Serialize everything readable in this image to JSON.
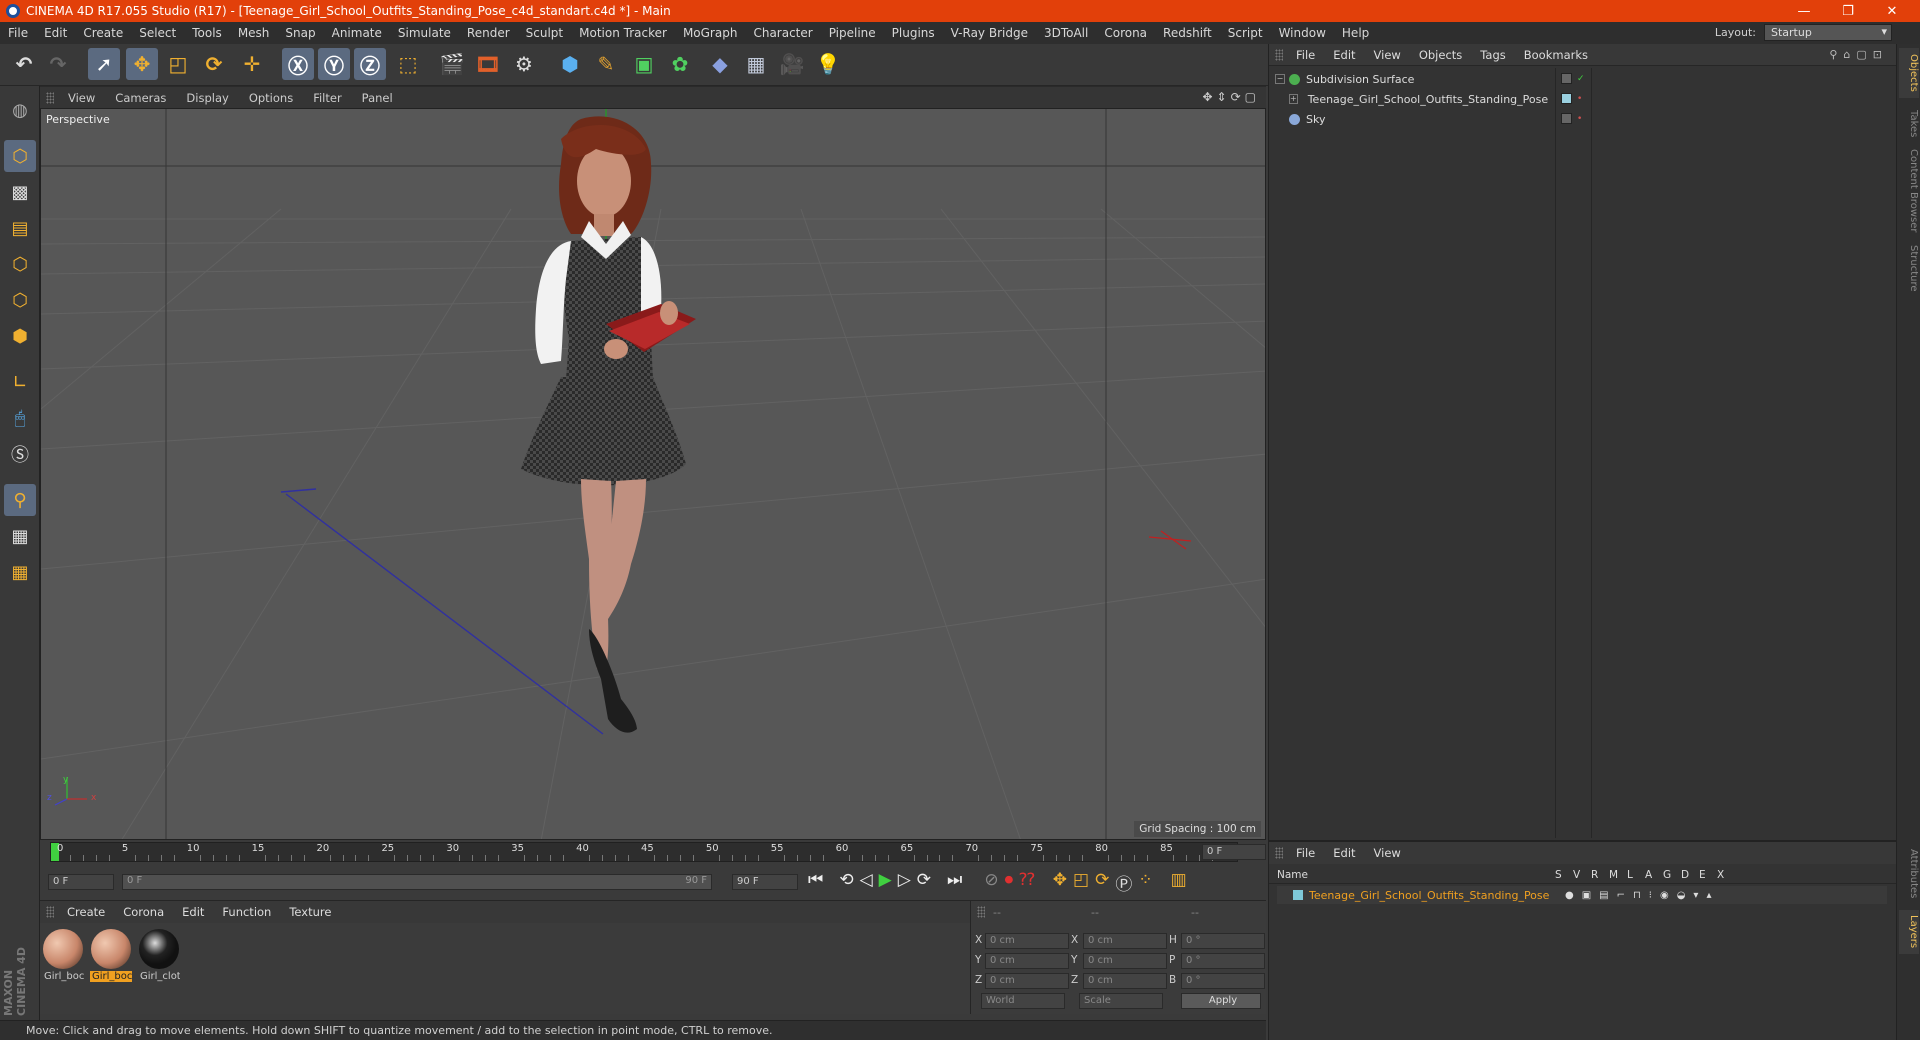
{
  "window": {
    "title": "CINEMA 4D R17.055 Studio (R17) - [Teenage_Girl_School_Outfits_Standing_Pose_c4d_standart.c4d *] - Main",
    "minimize": "—",
    "restore": "❐",
    "close": "✕"
  },
  "menu": [
    "File",
    "Edit",
    "Create",
    "Select",
    "Tools",
    "Mesh",
    "Snap",
    "Animate",
    "Simulate",
    "Render",
    "Sculpt",
    "Motion Tracker",
    "MoGraph",
    "Character",
    "Pipeline",
    "Plugins",
    "V-Ray Bridge",
    "3DToAll",
    "Corona",
    "Redshift",
    "Script",
    "Window",
    "Help"
  ],
  "layout": {
    "label": "Layout:",
    "value": "Startup"
  },
  "viewport": {
    "menu": [
      "View",
      "Cameras",
      "Display",
      "Options",
      "Filter",
      "Panel"
    ],
    "label": "Perspective",
    "grid_spacing": "Grid Spacing : 100 cm",
    "axis": {
      "x": "x",
      "y": "y",
      "z": "z"
    }
  },
  "timeline": {
    "ticks": [
      "0",
      "5",
      "10",
      "15",
      "20",
      "25",
      "30",
      "35",
      "40",
      "45",
      "50",
      "55",
      "60",
      "65",
      "70",
      "75",
      "80",
      "85",
      "90"
    ],
    "current_frame": "0 F",
    "start_field": "0 F",
    "range_start": "0 F",
    "range_end": "90 F",
    "end_field": "90 F"
  },
  "material_manager": {
    "menu": [
      "Create",
      "Corona",
      "Edit",
      "Function",
      "Texture"
    ],
    "materials": [
      {
        "label": "Girl_boc",
        "color": "#c8866a",
        "selected": false
      },
      {
        "label": "Girl_boc",
        "color": "#c8866a",
        "selected": true
      },
      {
        "label": "Girl_clot",
        "color": "#222222",
        "selected": false
      }
    ]
  },
  "coordinates": {
    "headers": [
      "--",
      "--",
      "--"
    ],
    "rows": [
      {
        "a": "X",
        "av": "0 cm",
        "b": "X",
        "bv": "0 cm",
        "c": "H",
        "cv": "0 °"
      },
      {
        "a": "Y",
        "av": "0 cm",
        "b": "Y",
        "bv": "0 cm",
        "c": "P",
        "cv": "0 °"
      },
      {
        "a": "Z",
        "av": "0 cm",
        "b": "Z",
        "bv": "0 cm",
        "c": "B",
        "cv": "0 °"
      }
    ],
    "mode": "World",
    "scale": "Scale",
    "apply": "Apply"
  },
  "status": "Move: Click and drag to move elements. Hold down SHIFT to quantize movement / add to the selection in point mode, CTRL to remove.",
  "object_manager": {
    "menu": [
      "File",
      "Edit",
      "View",
      "Objects",
      "Tags",
      "Bookmarks"
    ],
    "objects": [
      {
        "name": "Subdivision Surface",
        "indent": 0,
        "icon_color": "#4caf50"
      },
      {
        "name": "Teenage_Girl_School_Outfits_Standing_Pose",
        "indent": 1,
        "icon_color": "#9ab0c8"
      },
      {
        "name": "Sky",
        "indent": 0,
        "icon_color": "#8aa8d8"
      }
    ]
  },
  "layer_manager": {
    "menu": [
      "File",
      "Edit",
      "View"
    ],
    "columns": [
      "Name",
      "S",
      "V",
      "R",
      "M",
      "L",
      "A",
      "G",
      "D",
      "E",
      "X"
    ],
    "layers": [
      {
        "name": "Teenage_Girl_School_Outfits_Standing_Pose",
        "color": "#7ec8d8"
      }
    ]
  },
  "side_tabs": [
    "Objects",
    "Takes",
    "Content Browser",
    "Structure",
    "Attributes",
    "Layers"
  ],
  "brand": "MAXON CINEMA 4D",
  "colors": {
    "accent": "#e2400a",
    "selection": "#f0a020",
    "panel": "#333333"
  }
}
